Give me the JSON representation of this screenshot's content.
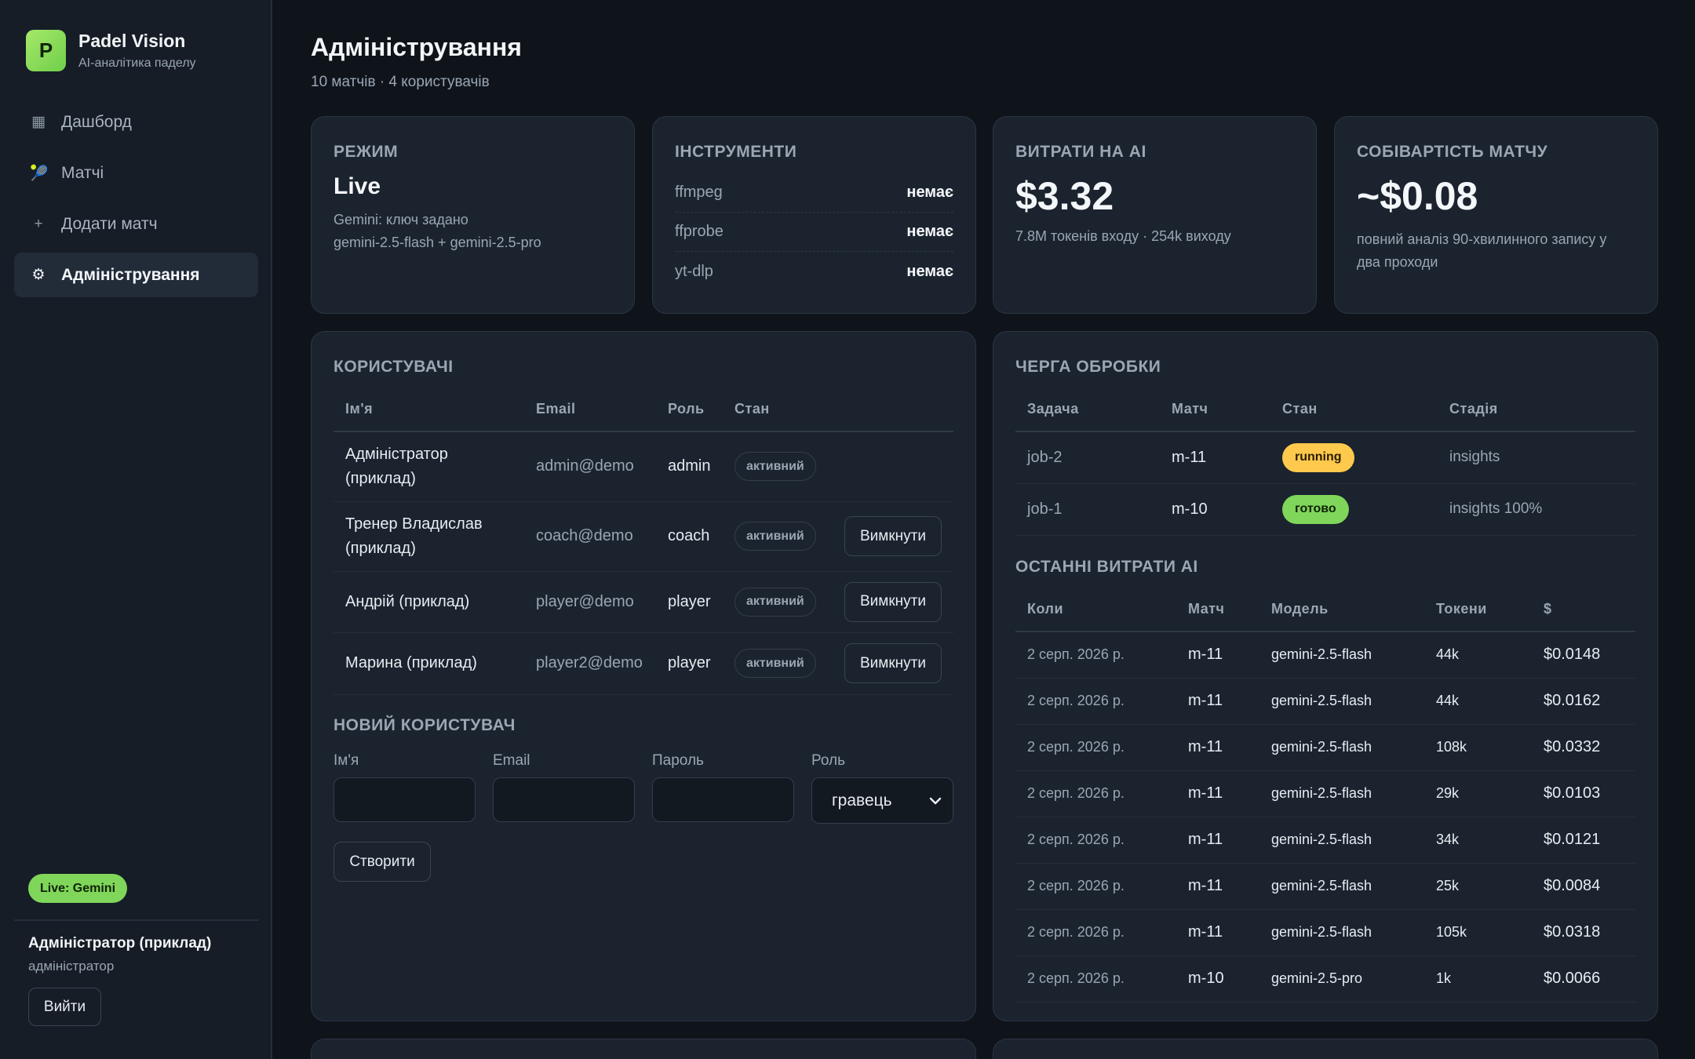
{
  "sidebar": {
    "logo_letter": "P",
    "brand_name": "Padel Vision",
    "brand_sub": "AI-аналітика паделу",
    "nav": [
      {
        "icon": "grid-icon",
        "glyph": "▦",
        "label": "Дашборд",
        "active": false
      },
      {
        "icon": "racket-icon",
        "glyph": "🎾",
        "label": "Матчі",
        "active": false
      },
      {
        "icon": "plus-icon",
        "glyph": "+",
        "label": "Додати матч",
        "active": false
      },
      {
        "icon": "gear-icon",
        "glyph": "⚙",
        "label": "Адміністрування",
        "active": true
      }
    ],
    "live_badge": "Live: Gemini",
    "user_name": "Адміністратор (приклад)",
    "user_role": "адміністратор",
    "logout_label": "Вийти"
  },
  "header": {
    "title": "Адміністрування",
    "subtitle": "10 матчів · 4 користувачів"
  },
  "mode_card": {
    "title": "Режим",
    "value": "Live",
    "line1": "Gemini: ключ задано",
    "line2": "gemini-2.5-flash + gemini-2.5-pro"
  },
  "tools_card": {
    "title": "Інструменти",
    "tools": [
      {
        "name": "ffmpeg",
        "status": "немає"
      },
      {
        "name": "ffprobe",
        "status": "немає"
      },
      {
        "name": "yt-dlp",
        "status": "немає"
      }
    ]
  },
  "cost_card": {
    "title": "Витрати на AI",
    "value": "$3.32",
    "note": "7.8M токенів входу · 254k виходу"
  },
  "match_cost_card": {
    "title": "Собівартість матчу",
    "value": "~$0.08",
    "note": "повний аналіз 90-хвилинного запису у два проходи"
  },
  "users": {
    "title": "Користувачі",
    "columns": [
      "Ім'я",
      "Email",
      "Роль",
      "Стан"
    ],
    "rows": [
      {
        "name": "Адміністратор (приклад)",
        "email": "admin@demo",
        "role": "admin",
        "state": "активний",
        "action": ""
      },
      {
        "name": "Тренер Владислав (приклад)",
        "email": "coach@demo",
        "role": "coach",
        "state": "активний",
        "action": "Вимкнути"
      },
      {
        "name": "Андрій (приклад)",
        "email": "player@demo",
        "role": "player",
        "state": "активний",
        "action": "Вимкнути"
      },
      {
        "name": "Марина (приклад)",
        "email": "player2@demo",
        "role": "player",
        "state": "активний",
        "action": "Вимкнути"
      }
    ]
  },
  "new_user": {
    "title": "Новий користувач",
    "name_label": "Ім'я",
    "email_label": "Email",
    "password_label": "Пароль",
    "role_label": "Роль",
    "role_value": "гравець",
    "create_label": "Створити"
  },
  "queue": {
    "title": "Черга обробки",
    "columns": [
      "Задача",
      "Матч",
      "Стан",
      "Стадія"
    ],
    "rows": [
      {
        "job": "job-2",
        "match": "m-11",
        "state": "running",
        "stage": "insights",
        "color": "#ffc94d"
      },
      {
        "job": "job-1",
        "match": "m-10",
        "state": "готово",
        "stage": "insights 100%",
        "color": "#7fd65a"
      }
    ]
  },
  "costs": {
    "title": "Останні витрати AI",
    "columns": [
      "Коли",
      "Матч",
      "Модель",
      "Токени",
      "$"
    ],
    "rows": [
      {
        "when": "2 серп. 2026 р.",
        "match": "m-11",
        "model": "gemini-2.5-flash",
        "tokens": "44k",
        "cost": "$0.0148"
      },
      {
        "when": "2 серп. 2026 р.",
        "match": "m-11",
        "model": "gemini-2.5-flash",
        "tokens": "44k",
        "cost": "$0.0162"
      },
      {
        "when": "2 серп. 2026 р.",
        "match": "m-11",
        "model": "gemini-2.5-flash",
        "tokens": "108k",
        "cost": "$0.0332"
      },
      {
        "when": "2 серп. 2026 р.",
        "match": "m-11",
        "model": "gemini-2.5-flash",
        "tokens": "29k",
        "cost": "$0.0103"
      },
      {
        "when": "2 серп. 2026 р.",
        "match": "m-11",
        "model": "gemini-2.5-flash",
        "tokens": "34k",
        "cost": "$0.0121"
      },
      {
        "when": "2 серп. 2026 р.",
        "match": "m-11",
        "model": "gemini-2.5-flash",
        "tokens": "25k",
        "cost": "$0.0084"
      },
      {
        "when": "2 серп. 2026 р.",
        "match": "m-11",
        "model": "gemini-2.5-flash",
        "tokens": "105k",
        "cost": "$0.0318"
      },
      {
        "when": "2 серп. 2026 р.",
        "match": "m-10",
        "model": "gemini-2.5-pro",
        "tokens": "1k",
        "cost": "$0.0066"
      }
    ]
  }
}
